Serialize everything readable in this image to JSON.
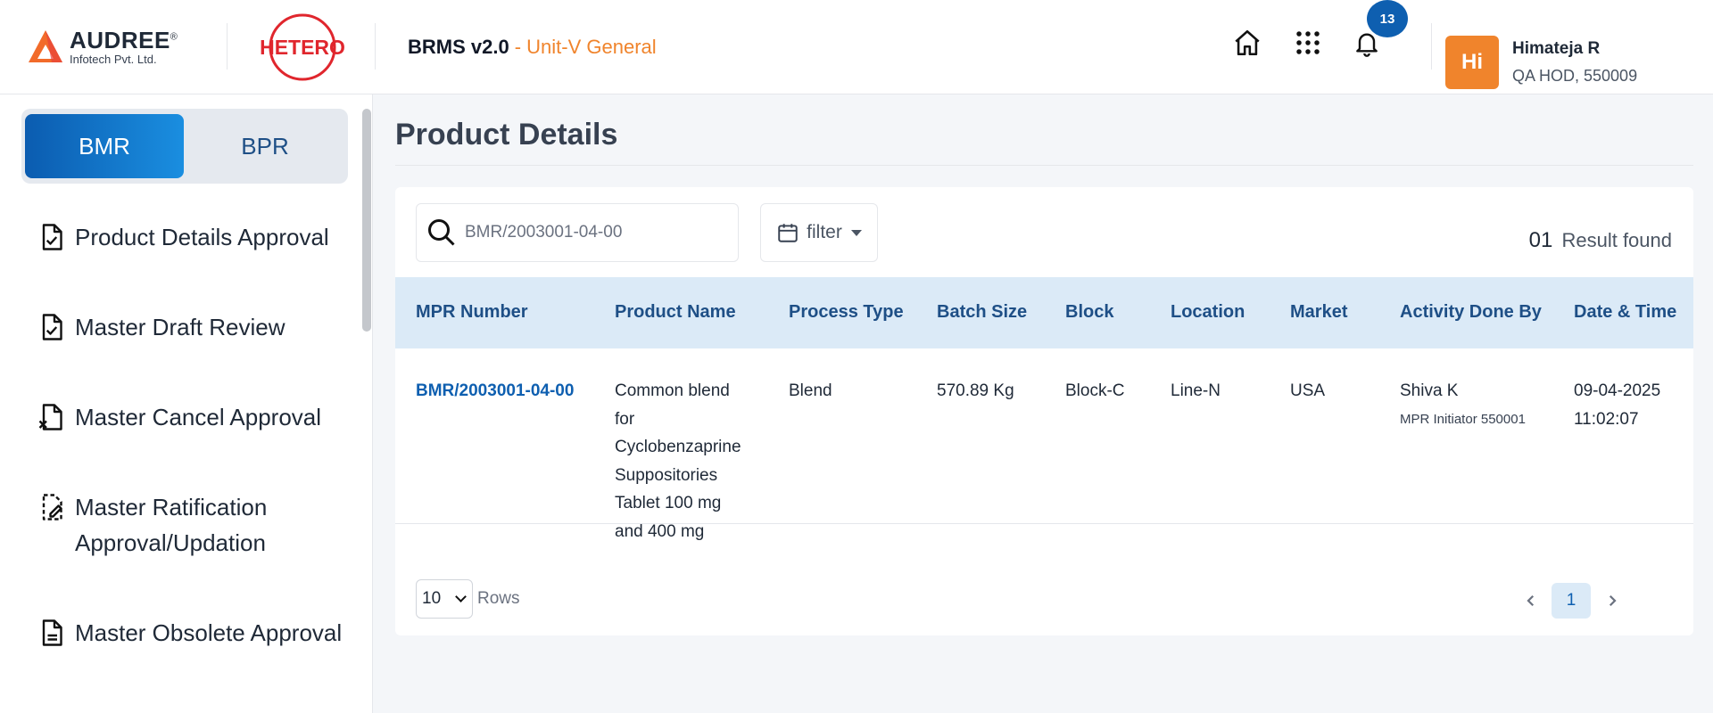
{
  "header": {
    "audree_brand": "AUDREE",
    "audree_reg": "®",
    "audree_sub": "Infotech Pvt. Ltd.",
    "hetero_brand": "HETERO",
    "app_name": "BRMS v2.0",
    "unit_name": "- Unit-V General",
    "notification_count": "13",
    "avatar_initials": "Hi",
    "user_name": "Himateja R",
    "user_role": "QA HOD, 550009",
    "icons": [
      "home-icon",
      "apps-grid-icon",
      "bell-icon"
    ],
    "accent_color": "#f0842c",
    "primary_color": "#0e5fb0"
  },
  "sidebar": {
    "toggle": {
      "bmr": "BMR",
      "bpr": "BPR",
      "selected": "BMR"
    },
    "items": [
      {
        "label": "Product Details Approval",
        "icon": "file-check-icon"
      },
      {
        "label": "Master Draft Review",
        "icon": "file-check-icon"
      },
      {
        "label": "Master Cancel Approval",
        "icon": "file-x-icon"
      },
      {
        "label": "Master Ratification Approval/Updation",
        "icon": "file-edit-icon"
      },
      {
        "label": "Master Obsolete Approval",
        "icon": "file-lines-icon"
      }
    ]
  },
  "main": {
    "title": "Product Details",
    "search": {
      "value": "BMR/2003001-04-00"
    },
    "filter_label": "filter",
    "result_count": "01",
    "result_label": "Result found",
    "columns": [
      "MPR Number",
      "Product Name",
      "Process Type",
      "Batch Size",
      "Block",
      "Location",
      "Market",
      "Activity Done By",
      "Date & Time"
    ],
    "rows": [
      {
        "mpr_number": "BMR/2003001-04-00",
        "product_name_lines": [
          "Common blend",
          "for",
          "Cyclobenzaprine",
          "Suppositories",
          "Tablet 100 mg",
          "and 400 mg"
        ],
        "process_type": "Blend",
        "batch_size": "570.89 Kg",
        "block": "Block-C",
        "location": "Line-N",
        "market": "USA",
        "activity_by": "Shiva K",
        "activity_by_sub": "MPR Initiator 550001",
        "date": "09-04-2025",
        "time": "11:02:07"
      }
    ],
    "rows_per_page": "10",
    "rows_label": "Rows",
    "current_page": "1"
  }
}
